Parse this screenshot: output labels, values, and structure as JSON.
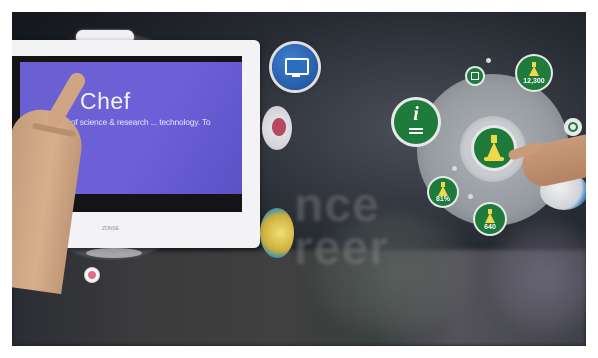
{
  "monitor": {
    "screen_title": "Chef",
    "screen_subtitle": "to Advance ... of science & research ... technology. To",
    "brand": "ZONSE"
  },
  "hub": {
    "node_top_value": "12,300",
    "node_left_value": "81%",
    "node_bottom_value": "640",
    "info_symbol": "i"
  },
  "background_text": {
    "line1": "nce",
    "line2": "reer"
  }
}
